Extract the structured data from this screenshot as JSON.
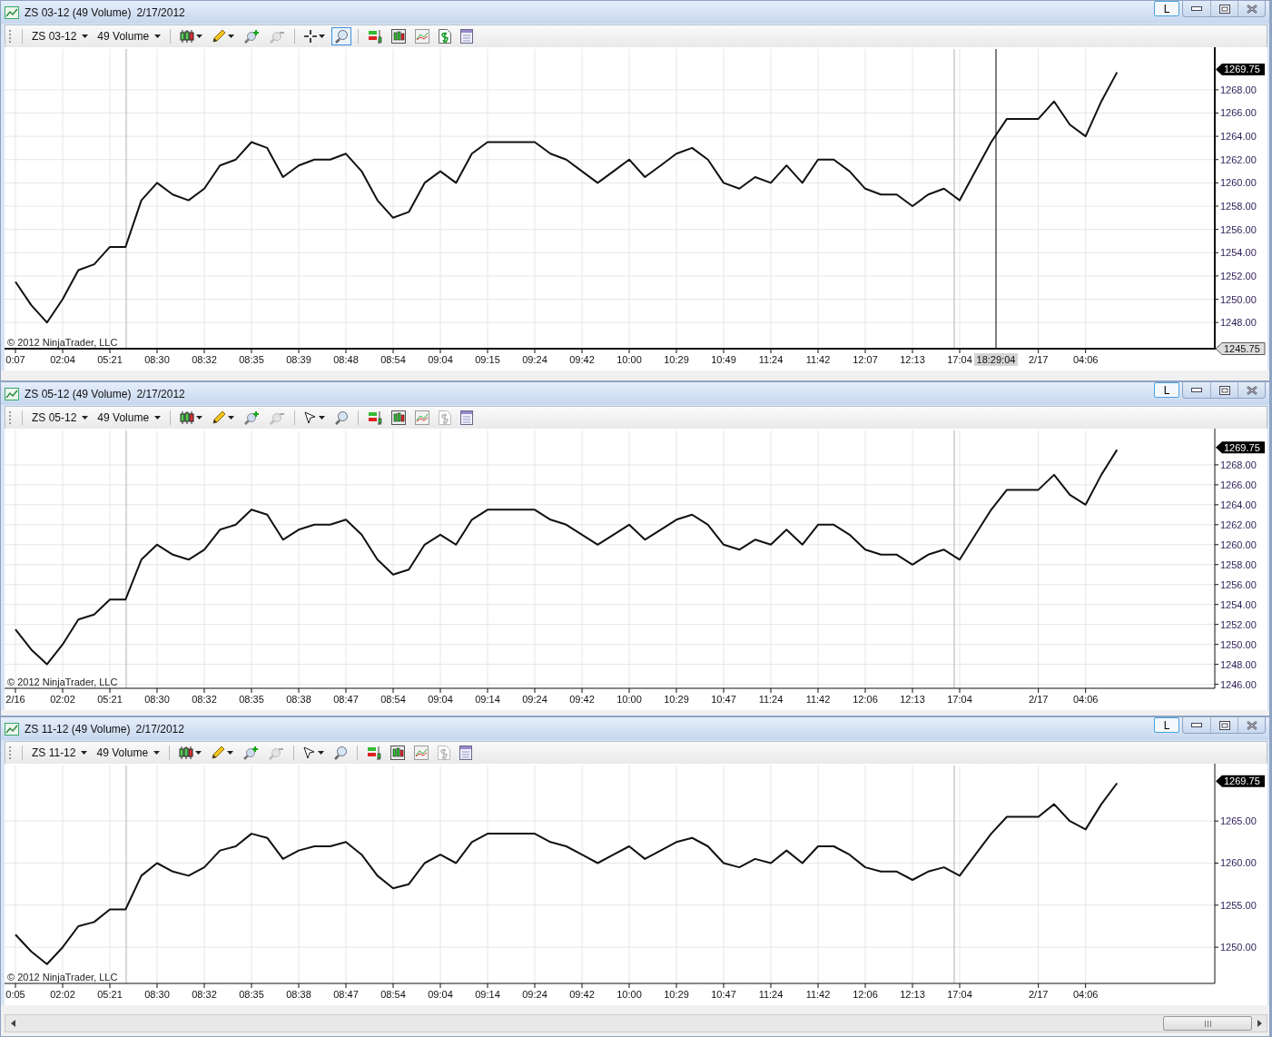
{
  "windows": [
    {
      "title": "ZS 03-12 (49 Volume)",
      "date": "2/17/2012",
      "link_label": "L",
      "toolbar": {
        "instrument": "ZS 03-12",
        "period": "49 Volume",
        "cursor_tool": {
          "kind": "crosshair"
        },
        "zoom_box_selected": true,
        "cash_disabled": false
      },
      "copyright": "© 2012 NinjaTrader, LLC",
      "last_price": "1269.75",
      "crosshair": {
        "time": "18:29:04",
        "price": "1245.75"
      },
      "chart_data": {
        "type": "line",
        "grid": true,
        "categories": [
          "0:07",
          null,
          null,
          "02:04",
          null,
          null,
          "05:21",
          null,
          null,
          "08:30",
          null,
          null,
          "08:32",
          null,
          null,
          "08:35",
          null,
          null,
          "08:39",
          null,
          null,
          "08:48",
          null,
          null,
          "08:54",
          null,
          null,
          "09:04",
          null,
          null,
          "09:15",
          null,
          null,
          "09:24",
          null,
          null,
          "09:42",
          null,
          null,
          "10:00",
          null,
          null,
          "10:29",
          null,
          null,
          "10:49",
          null,
          null,
          "11:24",
          null,
          null,
          "11:42",
          null,
          null,
          "12:07",
          null,
          null,
          "12:13",
          null,
          null,
          "17:04",
          null,
          null,
          null,
          null,
          "2/17",
          null,
          null,
          "04:06",
          null,
          null
        ],
        "values": [
          1251.5,
          1249.5,
          1248,
          1250,
          1252.5,
          1253,
          1254.5,
          1254.5,
          1258.5,
          1260,
          1259,
          1258.5,
          1259.5,
          1261.5,
          1262,
          1263.5,
          1263,
          1260.5,
          1261.5,
          1262,
          1262,
          1262.5,
          1261,
          1258.5,
          1257,
          1257.5,
          1260,
          1261,
          1260,
          1262.5,
          1263.5,
          1263.5,
          1263.5,
          1263.5,
          1262.5,
          1262,
          1261,
          1260,
          1261,
          1262,
          1260.5,
          1261.5,
          1262.5,
          1263,
          1262,
          1260,
          1259.5,
          1260.5,
          1260,
          1261.5,
          1260,
          1262,
          1262,
          1261,
          1259.5,
          1259,
          1259,
          1258,
          1259,
          1259.5,
          1258.5,
          1261,
          1263.5,
          1265.5,
          1265.5,
          1265.5,
          1267,
          1265,
          1264,
          1267,
          1269.5
        ],
        "ylim": [
          1245.75,
          1271.5
        ],
        "yticks": [
          {
            "value": 1248,
            "label": "1248.00"
          },
          {
            "value": 1250,
            "label": "1250.00"
          },
          {
            "value": 1252,
            "label": "1252.00"
          },
          {
            "value": 1254,
            "label": "1254.00"
          },
          {
            "value": 1256,
            "label": "1256.00"
          },
          {
            "value": 1258,
            "label": "1258.00"
          },
          {
            "value": 1260,
            "label": "1260.00"
          },
          {
            "value": 1262,
            "label": "1262.00"
          },
          {
            "value": 1264,
            "label": "1264.00"
          },
          {
            "value": 1266,
            "label": "1266.00"
          },
          {
            "value": 1268,
            "label": "1268.00"
          }
        ]
      }
    },
    {
      "title": "ZS 05-12 (49 Volume)",
      "date": "2/17/2012",
      "link_label": "L",
      "toolbar": {
        "instrument": "ZS 05-12",
        "period": "49 Volume",
        "cursor_tool": {
          "kind": "pointer"
        },
        "zoom_box_selected": false,
        "cash_disabled": true
      },
      "copyright": "© 2012 NinjaTrader, LLC",
      "last_price": "1269.75",
      "chart_data": {
        "type": "line",
        "grid": true,
        "categories": [
          "2/16",
          null,
          null,
          "02:02",
          null,
          null,
          "05:21",
          null,
          null,
          "08:30",
          null,
          null,
          "08:32",
          null,
          null,
          "08:35",
          null,
          null,
          "08:38",
          null,
          null,
          "08:47",
          null,
          null,
          "08:54",
          null,
          null,
          "09:04",
          null,
          null,
          "09:14",
          null,
          null,
          "09:24",
          null,
          null,
          "09:42",
          null,
          null,
          "10:00",
          null,
          null,
          "10:29",
          null,
          null,
          "10:47",
          null,
          null,
          "11:24",
          null,
          null,
          "11:42",
          null,
          null,
          "12:06",
          null,
          null,
          "12:13",
          null,
          null,
          "17:04",
          null,
          null,
          null,
          null,
          "2/17",
          null,
          null,
          "04:06",
          null,
          null
        ],
        "values": [
          1251.5,
          1249.5,
          1248,
          1250,
          1252.5,
          1253,
          1254.5,
          1254.5,
          1258.5,
          1260,
          1259,
          1258.5,
          1259.5,
          1261.5,
          1262,
          1263.5,
          1263,
          1260.5,
          1261.5,
          1262,
          1262,
          1262.5,
          1261,
          1258.5,
          1257,
          1257.5,
          1260,
          1261,
          1260,
          1262.5,
          1263.5,
          1263.5,
          1263.5,
          1263.5,
          1262.5,
          1262,
          1261,
          1260,
          1261,
          1262,
          1260.5,
          1261.5,
          1262.5,
          1263,
          1262,
          1260,
          1259.5,
          1260.5,
          1260,
          1261.5,
          1260,
          1262,
          1262,
          1261,
          1259.5,
          1259,
          1259,
          1258,
          1259,
          1259.5,
          1258.5,
          1261,
          1263.5,
          1265.5,
          1265.5,
          1265.5,
          1267,
          1265,
          1264,
          1267,
          1269.5
        ],
        "ylim": [
          1245.6,
          1271.45
        ],
        "yticks": [
          {
            "value": 1246,
            "label": "1246.00"
          },
          {
            "value": 1248,
            "label": "1248.00"
          },
          {
            "value": 1250,
            "label": "1250.00"
          },
          {
            "value": 1252,
            "label": "1252.00"
          },
          {
            "value": 1254,
            "label": "1254.00"
          },
          {
            "value": 1256,
            "label": "1256.00"
          },
          {
            "value": 1258,
            "label": "1258.00"
          },
          {
            "value": 1260,
            "label": "1260.00"
          },
          {
            "value": 1262,
            "label": "1262.00"
          },
          {
            "value": 1264,
            "label": "1264.00"
          },
          {
            "value": 1266,
            "label": "1266.00"
          },
          {
            "value": 1268,
            "label": "1268.00"
          }
        ]
      }
    },
    {
      "title": "ZS 11-12 (49 Volume)",
      "date": "2/17/2012",
      "link_label": "L",
      "toolbar": {
        "instrument": "ZS 11-12",
        "period": "49 Volume",
        "cursor_tool": {
          "kind": "pointer"
        },
        "zoom_box_selected": false,
        "cash_disabled": true
      },
      "copyright": "© 2012 NinjaTrader, LLC",
      "last_price": "1269.75",
      "chart_data": {
        "type": "line",
        "grid": true,
        "categories": [
          "0:05",
          null,
          null,
          "02:02",
          null,
          null,
          "05:21",
          null,
          null,
          "08:30",
          null,
          null,
          "08:32",
          null,
          null,
          "08:35",
          null,
          null,
          "08:38",
          null,
          null,
          "08:47",
          null,
          null,
          "08:54",
          null,
          null,
          "09:04",
          null,
          null,
          "09:14",
          null,
          null,
          "09:24",
          null,
          null,
          "09:42",
          null,
          null,
          "10:00",
          null,
          null,
          "10:29",
          null,
          null,
          "10:47",
          null,
          null,
          "11:24",
          null,
          null,
          "11:42",
          null,
          null,
          "12:06",
          null,
          null,
          "12:13",
          null,
          null,
          "17:04",
          null,
          null,
          null,
          null,
          "2/17",
          null,
          null,
          "04:06",
          null,
          null
        ],
        "values": [
          1251.5,
          1249.5,
          1248,
          1250,
          1252.5,
          1253,
          1254.5,
          1254.5,
          1258.5,
          1260,
          1259,
          1258.5,
          1259.5,
          1261.5,
          1262,
          1263.5,
          1263,
          1260.5,
          1261.5,
          1262,
          1262,
          1262.5,
          1261,
          1258.5,
          1257,
          1257.5,
          1260,
          1261,
          1260,
          1262.5,
          1263.5,
          1263.5,
          1263.5,
          1263.5,
          1262.5,
          1262,
          1261,
          1260,
          1261,
          1262,
          1260.5,
          1261.5,
          1262.5,
          1263,
          1262,
          1260,
          1259.5,
          1260.5,
          1260,
          1261.5,
          1260,
          1262,
          1262,
          1261,
          1259.5,
          1259,
          1259,
          1258,
          1259,
          1259.5,
          1258.5,
          1261,
          1263.5,
          1265.5,
          1265.5,
          1265.5,
          1267,
          1265,
          1264,
          1267,
          1269.5
        ],
        "ylim": [
          1245.7,
          1271.6
        ],
        "yticks": [
          {
            "value": 1250,
            "label": "1250.00"
          },
          {
            "value": 1255,
            "label": "1255.00"
          },
          {
            "value": 1260,
            "label": "1260.00"
          },
          {
            "value": 1265,
            "label": "1265.00"
          }
        ]
      }
    }
  ]
}
